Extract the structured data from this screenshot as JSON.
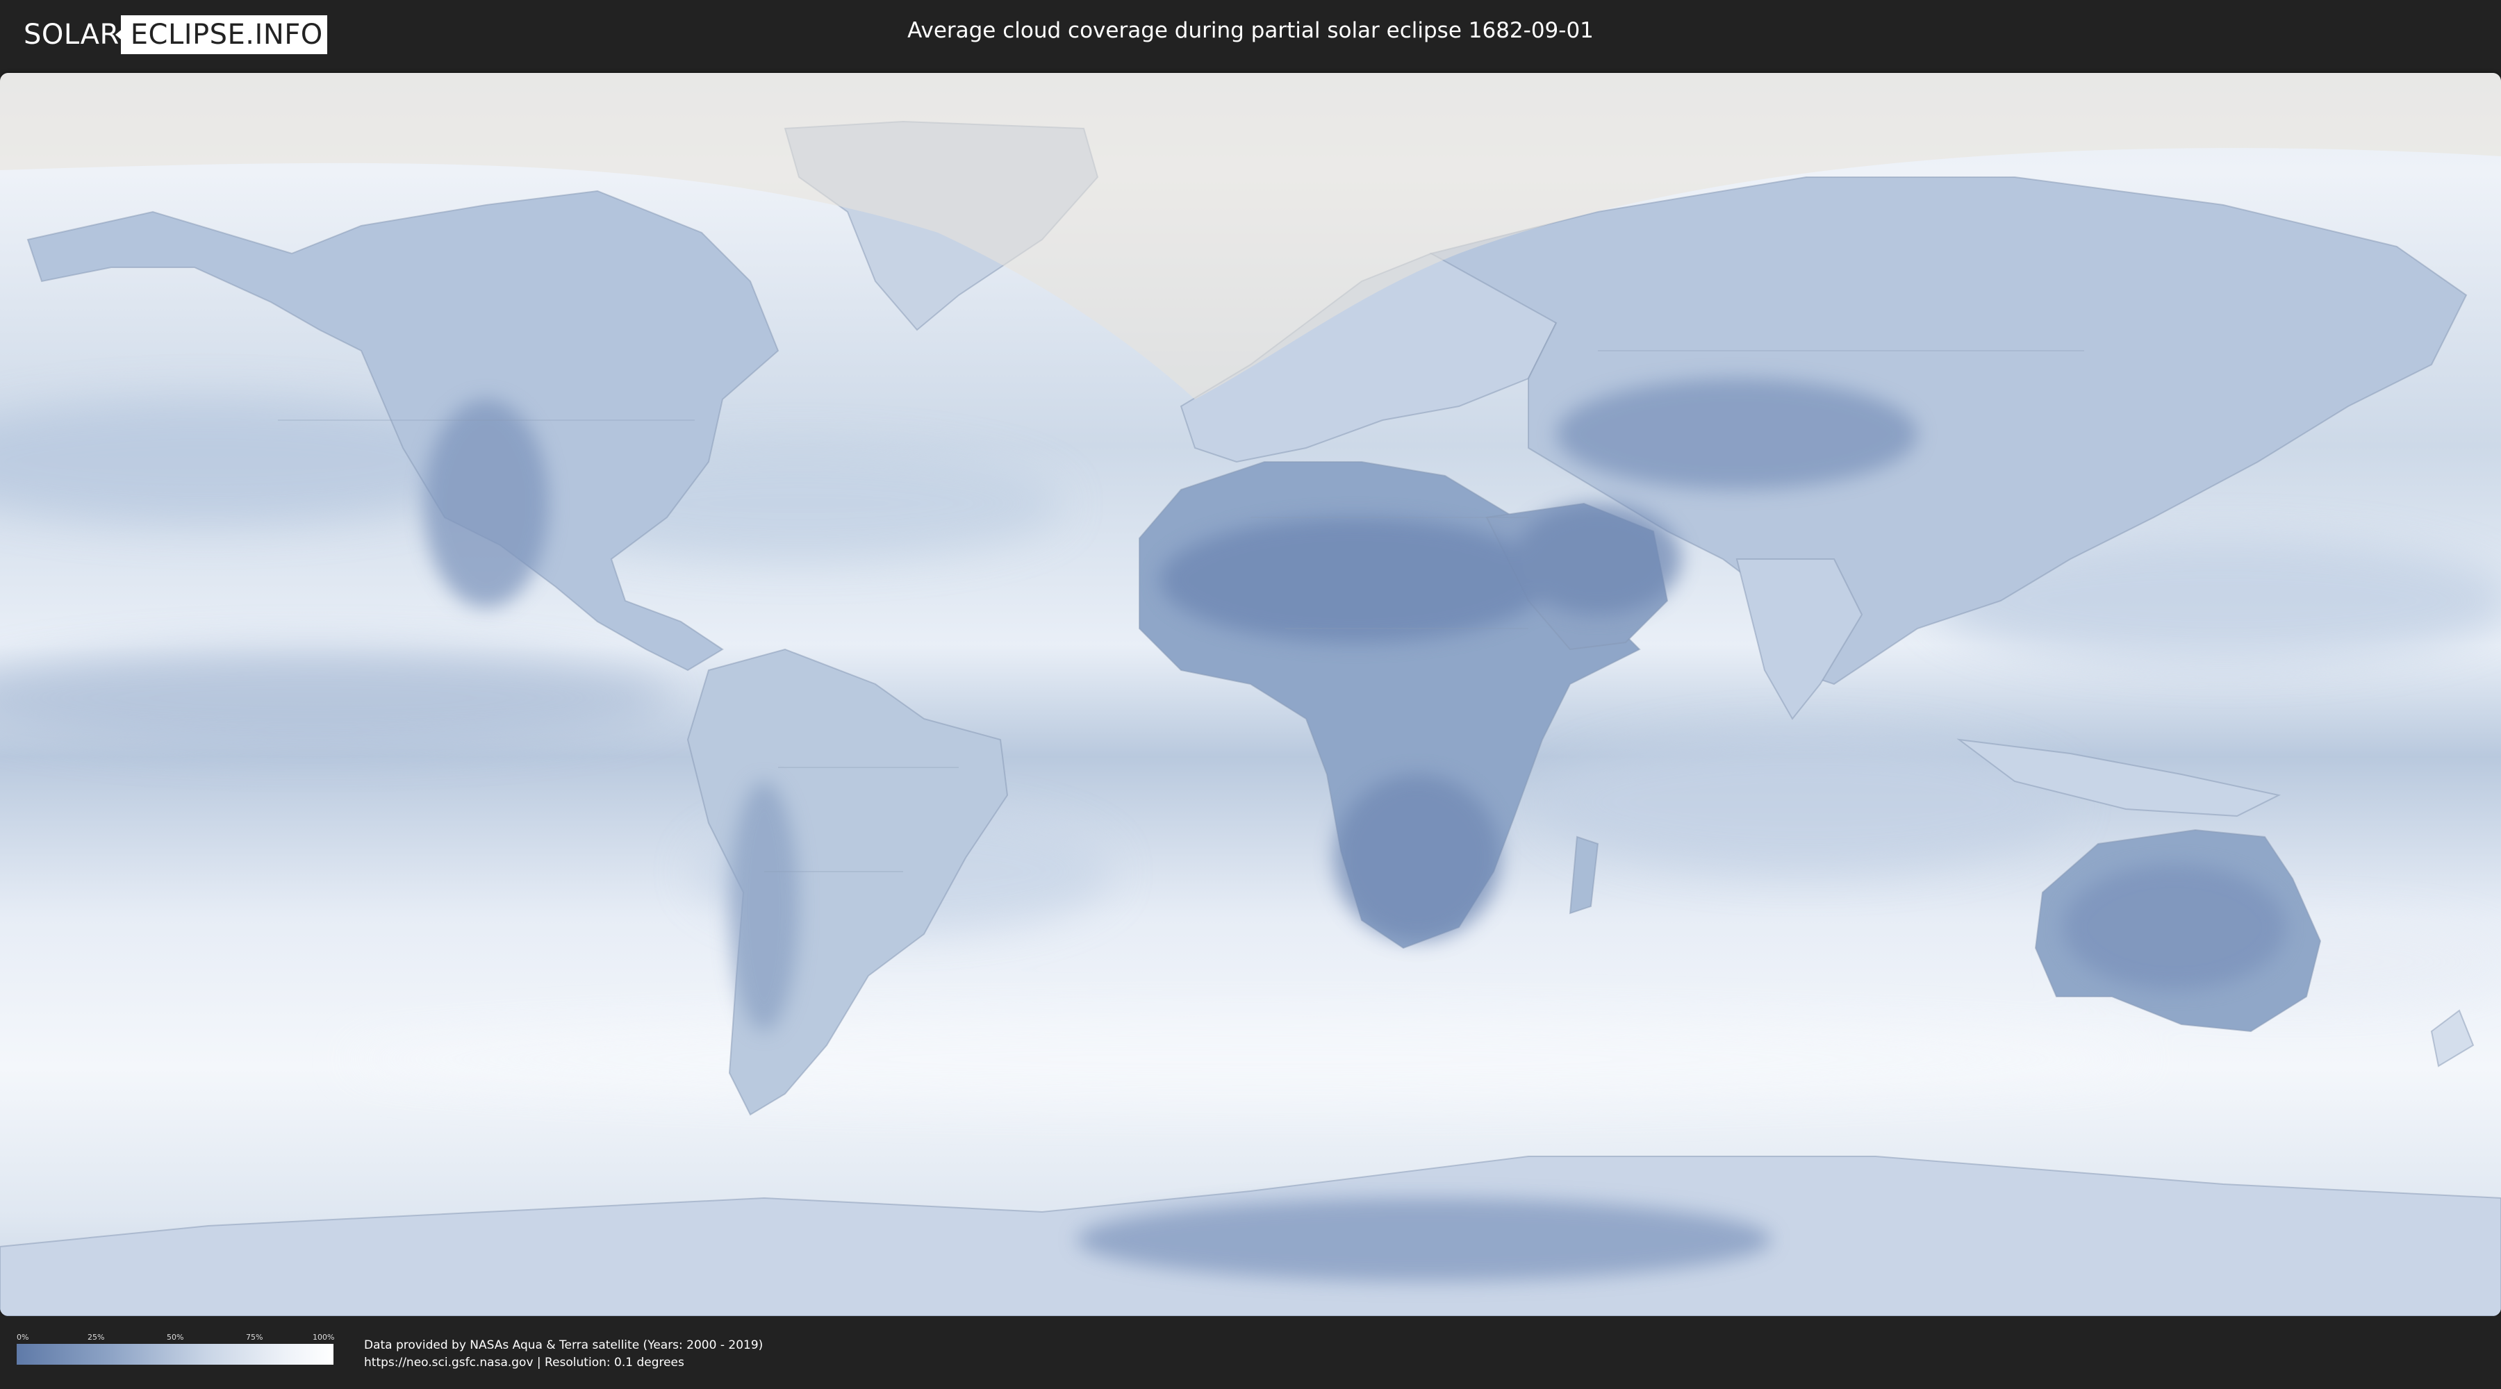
{
  "header": {
    "logo_left": "SOLAR",
    "logo_right": "ECLIPSE.INFO",
    "title": "Average cloud coverage during partial solar eclipse 1682-09-01"
  },
  "map": {
    "layer": "average cloud coverage",
    "colors": {
      "clear": "#5f7aa8",
      "mid": "#a9bcd6",
      "overcast": "#f4f7fb",
      "eclipse_shadow_overlay": "#e9e3da",
      "background": "#222222"
    }
  },
  "legend": {
    "ticks": [
      "0%",
      "25%",
      "50%",
      "75%",
      "100%"
    ],
    "gradient": [
      "#5f7aa8",
      "#8ea4c6",
      "#c9d5e6",
      "#eef2f8",
      "#ffffff"
    ]
  },
  "footer": {
    "credit_line1": "Data provided by NASAs Aqua & Terra satellite (Years: 2000 - 2019)",
    "credit_line2": "https://neo.sci.gsfc.nasa.gov | Resolution: 0.1 degrees"
  }
}
